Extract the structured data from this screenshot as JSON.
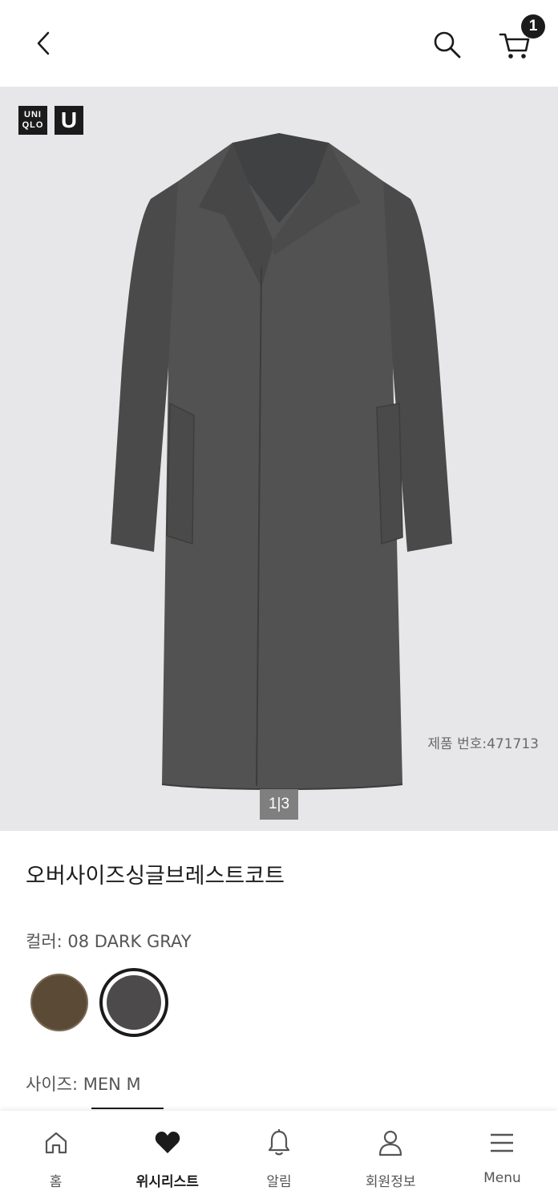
{
  "header": {
    "cart_count": "1"
  },
  "gallery": {
    "brand_logo_line1": "UNI",
    "brand_logo_line2": "QLO",
    "brand_logo_u": "U",
    "product_number": "제품 번호:471713",
    "page_indicator": "1|3"
  },
  "product": {
    "title": "오버사이즈싱글브레스트코트",
    "color_label": "컬러: 08 DARK GRAY",
    "size_label": "사이즈: MEN M",
    "colors": [
      "#5a4a36",
      "#4c4a4b"
    ]
  },
  "bottom_nav": {
    "items": [
      {
        "label": "홈",
        "icon": "home-icon"
      },
      {
        "label": "위시리스트",
        "icon": "heart-icon"
      },
      {
        "label": "알림",
        "icon": "bell-icon"
      },
      {
        "label": "회원정보",
        "icon": "user-icon"
      },
      {
        "label": "Menu",
        "icon": "menu-icon"
      }
    ]
  }
}
